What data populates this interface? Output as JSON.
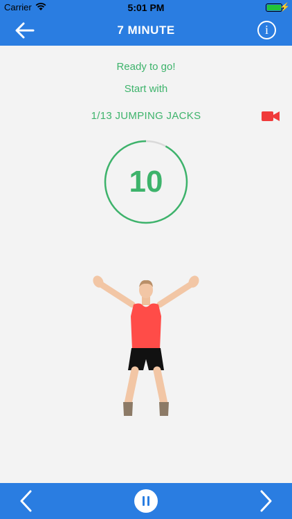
{
  "status_bar": {
    "carrier": "Carrier",
    "time": "5:01 PM",
    "battery_level": 1.0
  },
  "nav": {
    "title": "7 MINUTE",
    "info_label": "i"
  },
  "workout": {
    "status": "Ready to go!",
    "start_with": "Start with",
    "exercise": "1/13 JUMPING JACKS",
    "countdown": "10",
    "countdown_progress": 0.92
  },
  "colors": {
    "primary": "#2a7de1",
    "accent_green": "#3db36b",
    "video_red": "#f03a3a",
    "ring_track": "#d9d9d9"
  },
  "icons": {
    "back": "arrow-left-icon",
    "info": "info-icon",
    "video": "video-camera-icon",
    "prev": "chevron-left-icon",
    "pause": "pause-icon",
    "next": "chevron-right-icon"
  }
}
